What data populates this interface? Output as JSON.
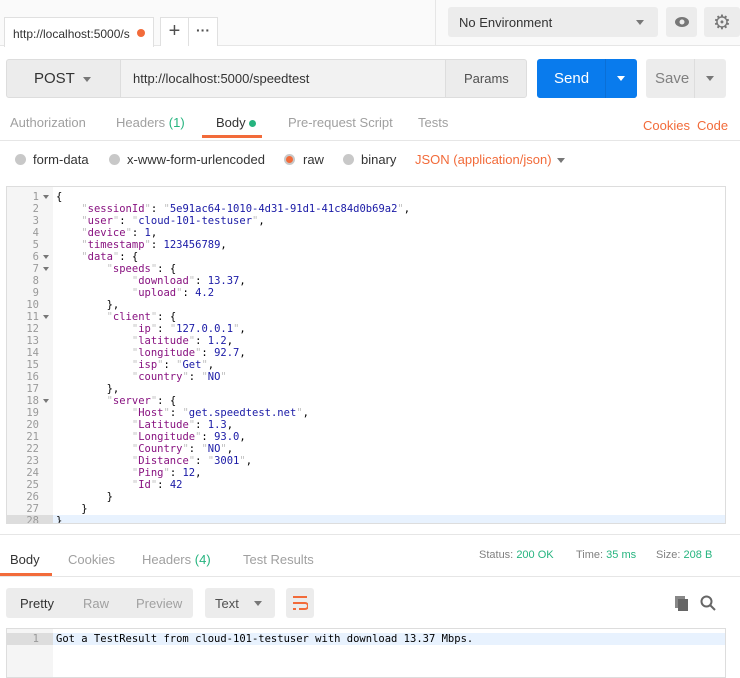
{
  "tabbar": {
    "tab_title": "http://localhost:5000/s",
    "new_tab_icon": "plus-icon",
    "more_icon": "ellipsis-icon"
  },
  "environment": {
    "selected": "No Environment"
  },
  "request": {
    "method": "POST",
    "url": "http://localhost:5000/speedtest",
    "params_label": "Params",
    "send_label": "Send",
    "save_label": "Save"
  },
  "request_tabs": [
    {
      "label": "Authorization"
    },
    {
      "label": "Headers",
      "count": "(1)"
    },
    {
      "label": "Body"
    },
    {
      "label": "Pre-request Script"
    },
    {
      "label": "Tests"
    }
  ],
  "links": {
    "cookies": "Cookies",
    "code": "Code"
  },
  "body_modes": {
    "options": [
      "form-data",
      "x-www-form-urlencoded",
      "raw",
      "binary"
    ],
    "selected": "raw",
    "content_type": "JSON (application/json)"
  },
  "request_body_lines": [
    "{",
    "    \"sessionId\": \"5e91ac64-1010-4d31-91d1-41c84d0b69a2\",",
    "    \"user\": \"cloud-101-testuser\",",
    "    \"device\": 1,",
    "    \"timestamp\": 123456789,",
    "    \"data\": {",
    "        \"speeds\": {",
    "            \"download\": 13.37,",
    "            \"upload\": 4.2",
    "        },",
    "        \"client\": {",
    "            \"ip\": \"127.0.0.1\",",
    "            \"latitude\": 1.2,",
    "            \"longitude\": 92.7,",
    "            \"isp\": \"Get\",",
    "            \"country\": \"NO\"",
    "        },",
    "        \"server\": {",
    "            \"Host\": \"get.speedtest.net\",",
    "            \"Latitude\": 1.3,",
    "            \"Longitude\": 93.0,",
    "            \"Country\": \"NO\",",
    "            \"Distance\": \"3001\",",
    "            \"Ping\": 12,",
    "            \"Id\": 42",
    "        }",
    "    }",
    "}"
  ],
  "response": {
    "tabs": [
      {
        "label": "Body"
      },
      {
        "label": "Cookies"
      },
      {
        "label": "Headers",
        "count": "(4)"
      },
      {
        "label": "Test Results"
      }
    ],
    "status_label": "Status:",
    "status": "200 OK",
    "time_label": "Time:",
    "time": "35 ms",
    "size_label": "Size:",
    "size": "208 B",
    "views": [
      "Pretty",
      "Raw",
      "Preview"
    ],
    "format": "Text",
    "lines": [
      "Got a TestResult from cloud-101-testuser with download 13.37 Mbps."
    ]
  },
  "colors": {
    "accent": "#f26b3a",
    "send": "#097bed",
    "success": "#26b47f"
  }
}
